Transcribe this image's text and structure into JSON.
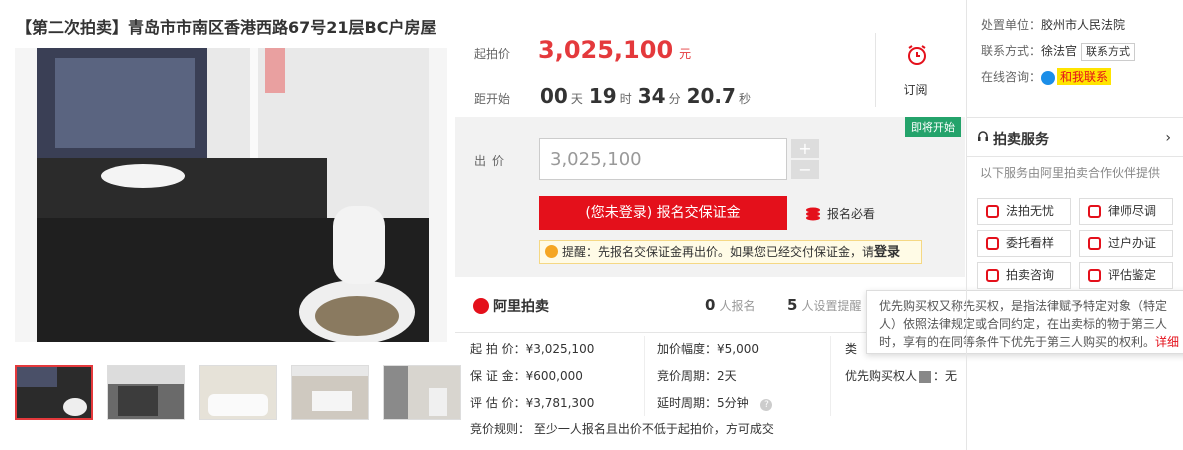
{
  "title": "【第二次拍卖】青岛市市南区香港西路67号21层BC户房屋",
  "price": {
    "label": "起拍价",
    "value": "3,025,100",
    "unit": "元"
  },
  "countdown": {
    "label": "距开始",
    "days": "00",
    "day_unit": "天",
    "hours": "19",
    "hour_unit": "时",
    "minutes": "34",
    "minute_unit": "分",
    "seconds": "20.7",
    "second_unit": "秒"
  },
  "subscribe": {
    "label": "订阅"
  },
  "bid": {
    "badge": "即将开始",
    "label": "出价",
    "input_value": "3,025,100",
    "plus": "+",
    "minus": "−",
    "register_button": "(您未登录) 报名交保证金",
    "must_read": "报名必看",
    "tip_prefix": "提醒：先报名交保证金再出价。如果您已经交付保证金，请",
    "tip_login": "登录"
  },
  "stats": {
    "logo": "阿里拍卖",
    "signed_count": "0",
    "signed_label": "人报名",
    "reminder_count": "5",
    "reminder_label": "人设置提醒"
  },
  "details": {
    "start_price": "起 拍 价：¥3,025,100",
    "deposit": "保 证 金：¥600,000",
    "appraisal": "评 估 价：¥3,781,300",
    "rules": "竞价规则：   至少一人报名且出价不低于起拍价，方可成交",
    "increment": "加价幅度：¥5,000",
    "cycle": "竞价周期：2天",
    "delay": "延时周期：5分钟",
    "type_partial": "类",
    "priority": "优先购买权人",
    "priority_value": "：无"
  },
  "tooltip": {
    "text": "优先购买权又称先买权，是指法律赋予特定对象（特定人）依照法律规定或合同约定，在出卖标的物于第三人时，享有的在同等条件下优先于第三人购买的权利。",
    "link": "详细"
  },
  "side": {
    "court_key": "处置单位：",
    "court_val": "胶州市人民法院",
    "contact_key": "联系方式：",
    "contact_name": "徐法官",
    "contact_btn": "联系方式",
    "online_key": "在线咨询：",
    "online_btn": "和我联系",
    "service_title": "拍卖服务",
    "service_sub": "以下服务由阿里拍卖合作伙伴提供",
    "services": [
      "法拍无忧",
      "律师尽调",
      "委托看样",
      "过户办证",
      "拍卖咨询",
      "评估鉴定"
    ]
  },
  "colors": {
    "accent": "#e4393c",
    "green": "#24a36b"
  }
}
